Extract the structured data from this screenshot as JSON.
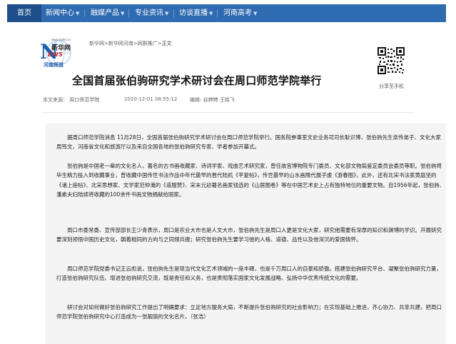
{
  "nav": {
    "home": "首页",
    "items": [
      {
        "label": "新闻中心",
        "arrow": "▼"
      },
      {
        "label": "融媒产品",
        "arrow": "▼"
      },
      {
        "label": "专业资讯",
        "arrow": "▼"
      },
      {
        "label": "访谈直播",
        "arrow": "▼"
      },
      {
        "label": "河南高考",
        "arrow": "▼"
      }
    ]
  },
  "logo": {
    "url": "www.news.cn",
    "big_letter": "N",
    "name_cn": "新华网",
    "news": "EWS",
    "channel": "河南频道"
  },
  "breadcrumb": {
    "items": [
      "新华网",
      "新华网河南",
      "网群推广"
    ],
    "separator": ">",
    "current": "正文"
  },
  "qr": {
    "label": "分享至手机"
  },
  "article": {
    "title": "全国首届张伯驹研究学术研讨会在周口师范学院举行",
    "source": "本文来源：  周口师范学院",
    "date": "2020-12-01 08:55:12",
    "editor": "编辑: 谷婷婷  王晓飞",
    "paragraphs": [
      "据周口师范学院消息 11月28日，全国首届张伯驹研究学术研讨会在周口师范学院举行。国务院参事室文史业务司司长耿识博，张伯驹先生亲传弟子、文化大家周笃文，河南省文化和旅游厅以及来自全国各地的张伯驹研究专家、学者参加开幕式。",
      "张伯驹是中国老一辈的文化名人，著名的古书画收藏家、诗词学家、戏曲艺术研究家，曾任故宫博物院专门委员、文化部文物局鉴定委员会委员等职。张伯驹将毕生精力投入到收藏事业，曾收藏中国传世书法作品中年代最早的晋代陆机《平复帖》，传世最早的山水画隋代展子虔《游春图》，此外，还有北宋书法家黄庭坚的《诸上座帖》、北宋思想家、文学家范仲淹的《道服赞》、宋末元初著名画家钱选的《山居图卷》等在中国艺术史上占有独特地位的重要文物。自1956年起，张伯驹、潘素夫妇陆续将收藏的100余件书画文物捐献给国家。",
      "周口市委常委、宣传部部长王少青表示，周口是农业大市也是人文大市，张伯驹先生是周口人更是文化大家，研究他需要有深厚的知识和渊博的学识。开展研究要深刻领悟中国历史文化，朝着相同的方向与之同频共振；研究张伯驹先生要学习他的人格、道德、品性以及他深沉的爱国情怀。",
      "周口师范学院党委书记王云彪说，张伯驹先生是现当代文化艺术领域的一座丰碑，也是千万周口人的自豪和骄傲。搭建张伯驹研究平台、凝聚张伯驹研究力量，打造张伯驹研究队伍、增进张伯驹研究交流，既是责任和义务，也是贯彻落实国家文化发展战略、弘扬中华优秀传统文化的需要。",
      "研讨会对如何做好张伯驹研究工作提出了明确要求：立足地方服务大局，不断提升张伯驹研究的社会影响力；在实现基础上推进，齐心协力、共享共建，把周口师范学院张伯驹研究中心打造成为一张靓丽的文化名片。（张浩）"
    ]
  }
}
